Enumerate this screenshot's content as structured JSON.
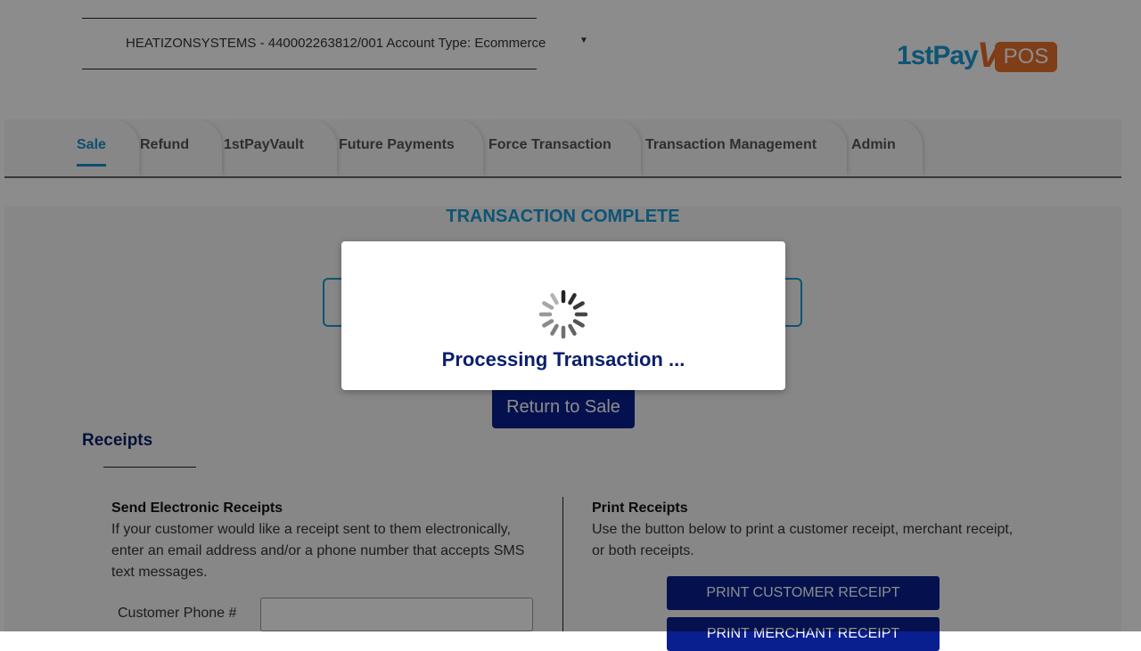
{
  "header": {
    "account_label": "HEATIZONSYSTEMS - 440002263812/001 Account Type: Ecommerce",
    "dropdown_caret": "▼",
    "logo": {
      "brand_text": "1stPay",
      "product_text": "POS",
      "brand_color": "#1a9ad6",
      "accent_color": "#e8722a"
    }
  },
  "tabs": [
    {
      "label": "Sale",
      "active": true
    },
    {
      "label": "Refund",
      "active": false
    },
    {
      "label": "1stPayVault",
      "active": false
    },
    {
      "label": "Future Payments",
      "active": false
    },
    {
      "label": "Force Transaction",
      "active": false
    },
    {
      "label": "Transaction Management",
      "active": false
    },
    {
      "label": "Admin",
      "active": false
    }
  ],
  "main": {
    "title": "TRANSACTION COMPLETE",
    "return_button": "Return to Sale",
    "receipts_heading": "Receipts",
    "electronic": {
      "heading": "Send Electronic Receipts",
      "description": "If your customer would like a receipt sent to them electronically, enter an email address and/or a phone number that accepts SMS text messages.",
      "phone_label": "Customer Phone #",
      "phone_value": ""
    },
    "print": {
      "heading": "Print Receipts",
      "description": "Use the button below to print a customer receipt, merchant receipt, or both receipts.",
      "customer_button": "PRINT CUSTOMER RECEIPT",
      "merchant_button": "PRINT MERCHANT RECEIPT"
    }
  },
  "modal": {
    "message": "Processing Transaction ...",
    "spinner_icon": "loading-spinner-icon"
  },
  "colors": {
    "accent": "#1a9ad6",
    "button": "#0a1f8f",
    "heading": "#0a1f6b"
  }
}
